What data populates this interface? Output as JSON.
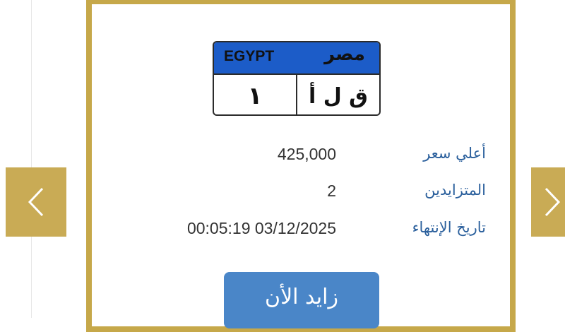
{
  "plate": {
    "country_en": "EGYPT",
    "country_ar": "مصر",
    "number": "١",
    "letters": "ق ل أ"
  },
  "details": {
    "highest_price_label": "أعلي سعر",
    "highest_price_value": "425,000",
    "bidders_label": "المتزايدين",
    "bidders_value": "2",
    "end_date_label": "تاريخ الإنتهاء",
    "end_date_value": "00:05:19 03/12/2025"
  },
  "actions": {
    "bid_now_label": "زايد الأن"
  },
  "carousel": {
    "prev_icon": "chevron-left-icon",
    "next_icon": "chevron-right-icon"
  },
  "colors": {
    "frame_gold": "#c6a84a",
    "plate_blue": "#1c5cc8",
    "label_blue": "#2a5f9c",
    "button_blue": "#4a86c8"
  }
}
